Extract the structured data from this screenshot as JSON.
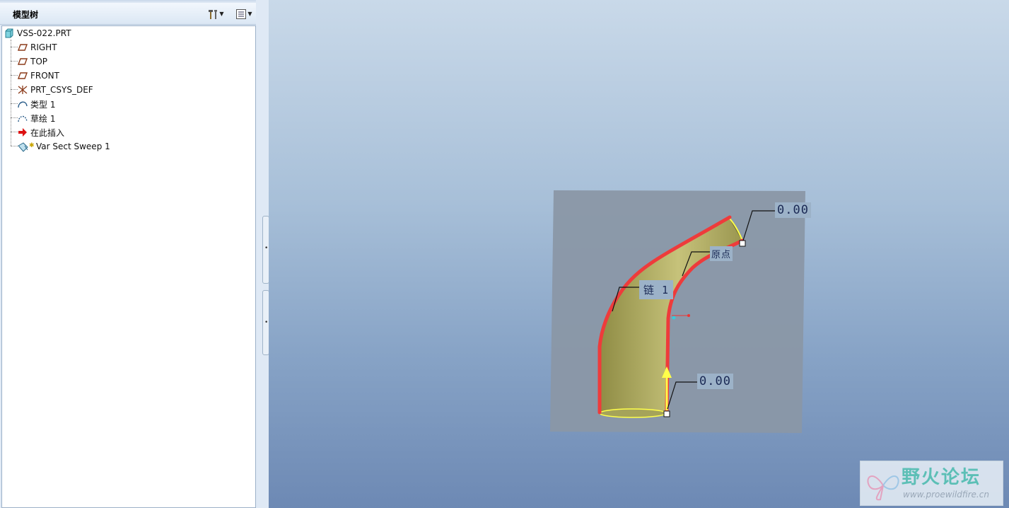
{
  "panel": {
    "title": "模型树",
    "tools_icon": "hammer-wrench-icon",
    "show_icon": "list-settings-icon"
  },
  "tree": {
    "root": {
      "label": "VSS-022.PRT",
      "icon": "part-icon"
    },
    "items": [
      {
        "label": "RIGHT",
        "icon": "datum-plane-icon"
      },
      {
        "label": "TOP",
        "icon": "datum-plane-icon"
      },
      {
        "label": "FRONT",
        "icon": "datum-plane-icon"
      },
      {
        "label": "PRT_CSYS_DEF",
        "icon": "csys-icon"
      },
      {
        "label": "类型 1",
        "icon": "curve-icon"
      },
      {
        "label": "草绘 1",
        "icon": "sketch-icon"
      },
      {
        "label": "在此插入",
        "icon": "insert-arrow-icon"
      },
      {
        "label": "Var Sect Sweep 1",
        "icon": "var-sect-sweep-icon"
      }
    ]
  },
  "viewport": {
    "labels": {
      "dim_top": "0.00",
      "origin": "原点",
      "chain": "链 1",
      "dim_bottom": "0.00"
    },
    "colors": {
      "surface": "#b8b46a",
      "trajectory": "#ee3b3b",
      "datum_plane": "#8a97a6",
      "highlight": "#ffff4a"
    }
  },
  "watermark": {
    "title": "野火论坛",
    "url": "www.proewildfire.cn"
  }
}
